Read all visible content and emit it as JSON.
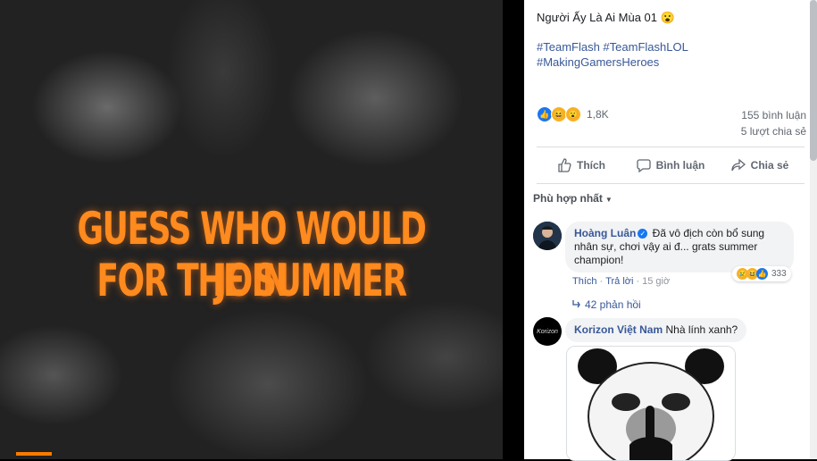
{
  "media": {
    "headline_line1": "GUESS WHO WOULD JOIN",
    "headline_line2": "FOR THE SUMMER"
  },
  "post": {
    "title": "Người Ấy Là Ai Mùa 01 😮",
    "hashtags": [
      "#TeamFlash #TeamFlashLOL",
      "#MakingGamersHeroes"
    ],
    "reactions": {
      "icons": [
        "like-icon",
        "haha-icon",
        "wow-icon"
      ],
      "count": "1,8K"
    },
    "comments_count": "155 bình luận",
    "shares_count": "5 lượt chia sẻ"
  },
  "actions": {
    "like": "Thích",
    "comment": "Bình luận",
    "share": "Chia sẻ"
  },
  "sort": {
    "label": "Phù hợp nhất"
  },
  "comments": [
    {
      "author": "Hoàng Luân",
      "text": "Đã vô địch còn bổ sung nhân sự, chơi vậy ai đ... grats summer champion!",
      "like_label": "Thích",
      "reply_label": "Trả lời",
      "time": "15 giờ",
      "reaction_count": "333",
      "replies_label": "42 phản hồi"
    },
    {
      "author": "Korizon Việt Nam",
      "text": "Nhà lính xanh?",
      "avatar_text": "Korizon"
    }
  ],
  "colors": {
    "accent": "#ff8a1e",
    "link": "#385898",
    "brand_blue": "#1877f2"
  }
}
